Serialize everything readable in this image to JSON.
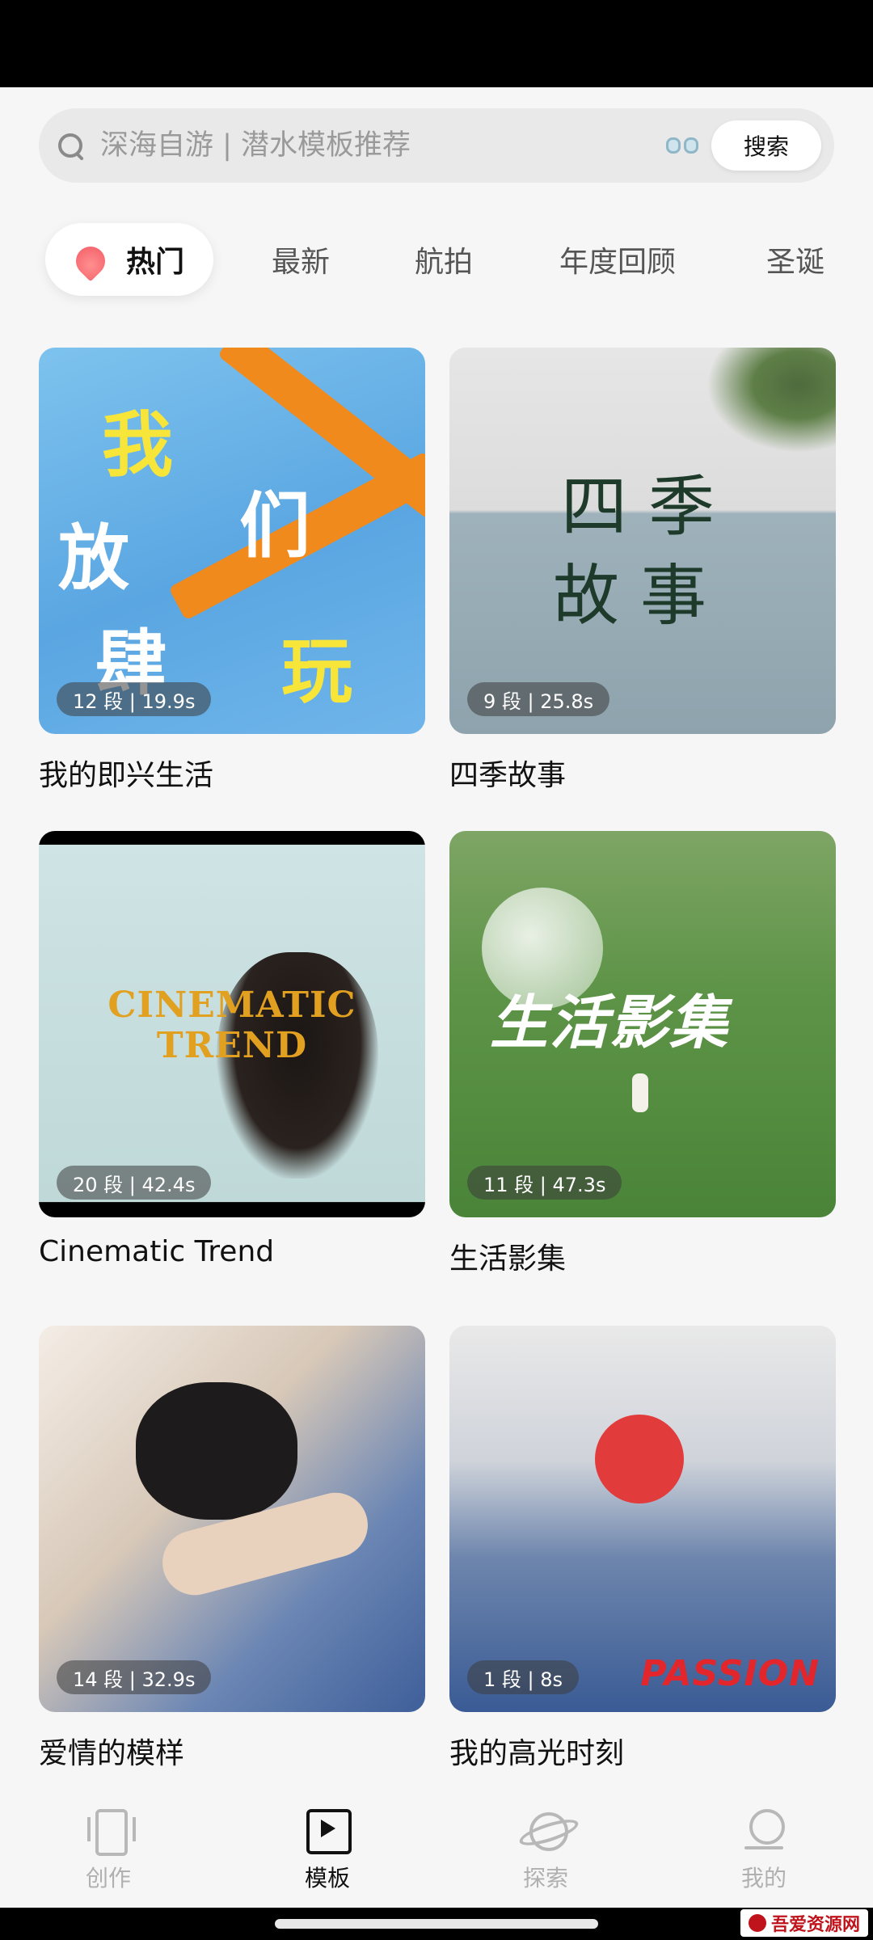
{
  "search": {
    "placeholder": "深海自游 | 潜水模板推荐",
    "button_label": "搜索"
  },
  "tabs": [
    {
      "label": "热门",
      "active": true
    },
    {
      "label": "最新",
      "active": false
    },
    {
      "label": "航拍",
      "active": false
    },
    {
      "label": "年度回顾",
      "active": false
    },
    {
      "label": "圣诞",
      "active": false
    }
  ],
  "templates": [
    {
      "title": "我的即兴生活",
      "badge": "12 段 | 19.9s",
      "artwork_text": [
        "我",
        "们",
        "放",
        "肆",
        "玩"
      ]
    },
    {
      "title": "四季故事",
      "badge": "9 段 | 25.8s",
      "artwork_text": [
        "四季",
        "故事"
      ]
    },
    {
      "title": "Cinematic Trend",
      "badge": "20 段 | 42.4s",
      "artwork_text": [
        "CINEMATIC",
        "TREND"
      ]
    },
    {
      "title": "生活影集",
      "badge": "11 段 | 47.3s",
      "artwork_text": [
        "生活影集"
      ]
    },
    {
      "title": "爱情的模样",
      "badge": "14 段 | 32.9s",
      "artwork_text": []
    },
    {
      "title": "我的高光时刻",
      "badge": "1 段 | 8s",
      "artwork_text": [
        "PASSION"
      ]
    }
  ],
  "bottom_nav": [
    {
      "label": "创作",
      "icon": "phone-icon",
      "active": false
    },
    {
      "label": "模板",
      "icon": "play-icon",
      "active": true
    },
    {
      "label": "探索",
      "icon": "planet-icon",
      "active": false
    },
    {
      "label": "我的",
      "icon": "user-icon",
      "active": false
    }
  ],
  "watermark": {
    "text": "吾爱资源网"
  },
  "colors": {
    "background": "#f6f6f6",
    "tab_accent": "#f25a64",
    "active_text": "#111111",
    "inactive_text": "#b0b0b0"
  }
}
